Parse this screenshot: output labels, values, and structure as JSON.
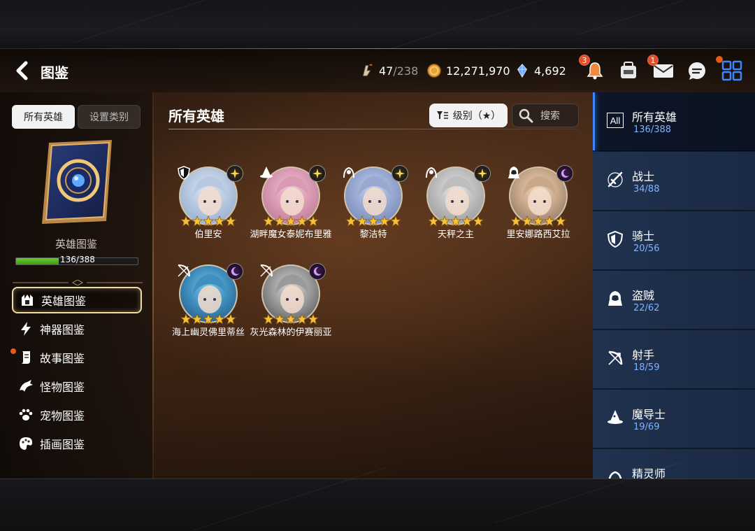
{
  "header": {
    "title": "图鉴",
    "stamina": {
      "current": "47",
      "max": "/238"
    },
    "gold": "12,271,970",
    "crystals": "4,692",
    "notifications_badge": "3",
    "mail_badge": "1"
  },
  "left": {
    "tabs": [
      "所有英雄",
      "设置类别"
    ],
    "book_label": "英雄图鉴",
    "progress_text": "136/388",
    "progress_fraction": 0.35,
    "menu": [
      {
        "label": "英雄图鉴",
        "icon": "hero-icon"
      },
      {
        "label": "神器图鉴",
        "icon": "lightning-icon"
      },
      {
        "label": "故事图鉴",
        "icon": "scroll-icon"
      },
      {
        "label": "怪物图鉴",
        "icon": "dragon-icon"
      },
      {
        "label": "宠物图鉴",
        "icon": "paw-icon"
      },
      {
        "label": "插画图鉴",
        "icon": "palette-icon"
      }
    ]
  },
  "center": {
    "title": "所有英雄",
    "filter_label": "级别（★）",
    "search_label": "搜索",
    "heroes": [
      {
        "name": "伯里安",
        "class": "knight",
        "element": "light",
        "stars": 5,
        "palette": [
          "#dfe8f5",
          "#b7c8e0",
          "#8aa4c8"
        ]
      },
      {
        "name": "湖畔魔女泰妮布里雅",
        "class": "mage",
        "element": "light",
        "stars": 5,
        "palette": [
          "#f3c9d8",
          "#d99bb3",
          "#b56d8e"
        ]
      },
      {
        "name": "黎洁特",
        "class": "soul-weaver",
        "element": "light",
        "stars": 5,
        "palette": [
          "#c9d3ec",
          "#98a8d1",
          "#6d7fb0"
        ]
      },
      {
        "name": "天秤之主",
        "class": "soul-weaver",
        "element": "light",
        "stars": 5,
        "palette": [
          "#e8e8e8",
          "#bdbdbd",
          "#8d8d8d"
        ]
      },
      {
        "name": "里安娜路西艾拉",
        "class": "thief",
        "element": "dark",
        "stars": 5,
        "palette": [
          "#eed9b8",
          "#c9a88a",
          "#7a6a5c"
        ]
      },
      {
        "name": "海上幽灵佛里蒂丝",
        "class": "ranger",
        "element": "dark",
        "stars": 5,
        "palette": [
          "#7fc6e6",
          "#3f8fbf",
          "#1f4e76"
        ]
      },
      {
        "name": "灰光森林的伊赛丽亚",
        "class": "ranger",
        "element": "dark",
        "stars": 5,
        "palette": [
          "#d8d8d8",
          "#9a9a9a",
          "#4a4a4a"
        ]
      }
    ]
  },
  "categories": [
    {
      "name": "所有英雄",
      "count": "136/388",
      "icon": "all-icon"
    },
    {
      "name": "战士",
      "count": "34/88",
      "icon": "sword-icon"
    },
    {
      "name": "骑士",
      "count": "20/56",
      "icon": "shield-icon"
    },
    {
      "name": "盗贼",
      "count": "22/62",
      "icon": "hood-icon"
    },
    {
      "name": "射手",
      "count": "18/59",
      "icon": "bow-icon"
    },
    {
      "name": "魔导士",
      "count": "19/69",
      "icon": "wizard-hat-icon"
    },
    {
      "name": "精灵师",
      "count": "",
      "icon": "spirit-icon"
    }
  ],
  "colors": {
    "accent_blue": "#3d86ff",
    "count_blue": "#7fb2ff",
    "progress_green": "#66cc2a",
    "badge_orange": "#e0502a"
  }
}
